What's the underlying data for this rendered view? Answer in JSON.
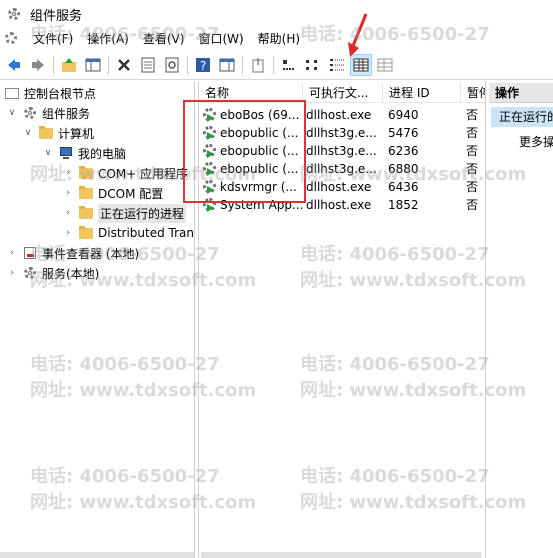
{
  "window": {
    "title": "组件服务"
  },
  "menu": [
    "文件(F)",
    "操作(A)",
    "查看(V)",
    "窗口(W)",
    "帮助(H)"
  ],
  "toolbar": {
    "buttons": [
      "back-icon",
      "forward-icon",
      "up-folder-icon",
      "show-tree-icon",
      "delete-icon",
      "properties-icon",
      "refresh-icon",
      "help-icon",
      "show-action-pane-icon",
      "export-list-icon",
      "large-icons-view-icon",
      "small-icons-view-icon",
      "list-view-icon",
      "details-view-icon",
      "status-view-icon"
    ],
    "active": "details-view-icon"
  },
  "tree": [
    {
      "label": "控制台根节点",
      "depth": 0,
      "expand": "",
      "icon": "console-root"
    },
    {
      "label": "组件服务",
      "depth": 1,
      "expand": "v",
      "icon": "gear"
    },
    {
      "label": "计算机",
      "depth": 2,
      "expand": "v",
      "icon": "folder"
    },
    {
      "label": "我的电脑",
      "depth": 3,
      "expand": "v",
      "icon": "computer"
    },
    {
      "label": "COM+ 应用程序",
      "depth": 4,
      "expand": ">",
      "icon": "folder"
    },
    {
      "label": "DCOM 配置",
      "depth": 4,
      "expand": ">",
      "icon": "folder"
    },
    {
      "label": "正在运行的进程",
      "depth": 4,
      "expand": ">",
      "icon": "folder",
      "selected": true
    },
    {
      "label": "Distributed Tran",
      "depth": 4,
      "expand": ">",
      "icon": "folder"
    },
    {
      "label": "事件查看器 (本地)",
      "depth": 0,
      "expand": ">",
      "icon": "event"
    },
    {
      "label": "服务(本地)",
      "depth": 0,
      "expand": ">",
      "icon": "service"
    }
  ],
  "list": {
    "columns": [
      "名称",
      "可执行文...",
      "进程 ID",
      "暂停"
    ],
    "rows": [
      {
        "name": "eboBos (69...",
        "exe": "dllhost.exe",
        "pid": "6940",
        "pause": "否"
      },
      {
        "name": "ebopublic (...",
        "exe": "dllhst3g.e...",
        "pid": "5476",
        "pause": "否"
      },
      {
        "name": "ebopublic (...",
        "exe": "dllhst3g.e...",
        "pid": "6236",
        "pause": "否"
      },
      {
        "name": "ebopublic (...",
        "exe": "dllhst3g.e...",
        "pid": "6880",
        "pause": "否"
      },
      {
        "name": "kdsvrmgr (...",
        "exe": "dllhost.exe",
        "pid": "6436",
        "pause": "否"
      },
      {
        "name": "System App...",
        "exe": "dllhost.exe",
        "pid": "1852",
        "pause": "否"
      }
    ]
  },
  "actions": {
    "title": "操作",
    "section": "正在运行的",
    "item": "更多操"
  },
  "watermark": {
    "phone": "电话: 4006-6500-27",
    "site": "网址: www.tdxsoft.com"
  },
  "colors": {
    "highlight": "#e03030",
    "selection": "#cce4f7"
  }
}
